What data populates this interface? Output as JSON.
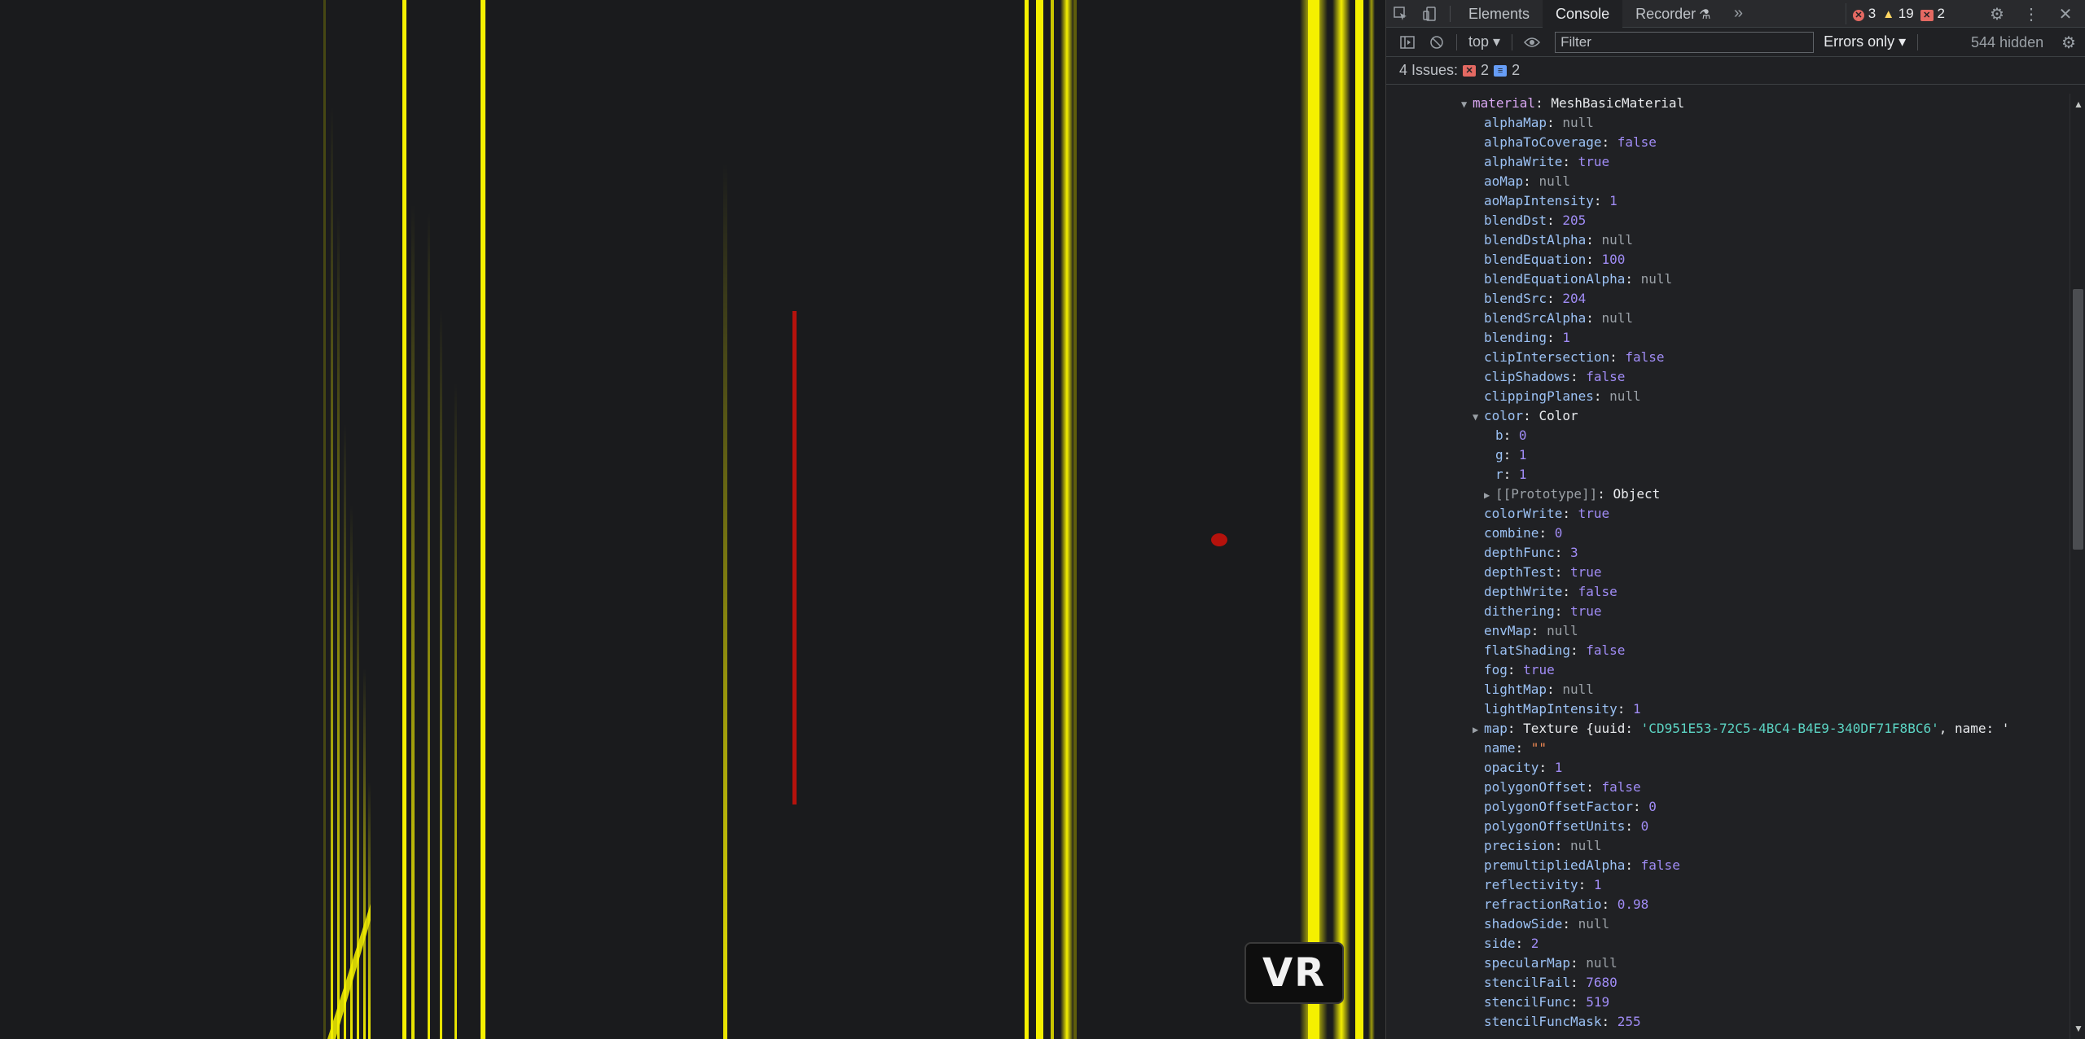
{
  "scene": {
    "vr_button_label": "VR"
  },
  "devtools": {
    "tabs": [
      {
        "label": "Elements",
        "active": false
      },
      {
        "label": "Console",
        "active": true
      },
      {
        "label": "Recorder",
        "active": false
      }
    ],
    "more_tabs_icon": "chevrons-right-icon",
    "counts": {
      "errors": "3",
      "warnings": "19",
      "issues": "2"
    },
    "toolbar": {
      "context": "top",
      "filter_placeholder": "Filter",
      "level": "Errors only",
      "hidden": "544 hidden"
    },
    "issues_bar": {
      "label": "4 Issues:",
      "errors": "2",
      "info": "2"
    },
    "object": {
      "name": "material",
      "type": "MeshBasicMaterial",
      "props": [
        {
          "key": "alphaMap",
          "value": "null",
          "kind": "null"
        },
        {
          "key": "alphaToCoverage",
          "value": "false",
          "kind": "bool"
        },
        {
          "key": "alphaWrite",
          "value": "true",
          "kind": "bool"
        },
        {
          "key": "aoMap",
          "value": "null",
          "kind": "null"
        },
        {
          "key": "aoMapIntensity",
          "value": "1",
          "kind": "num"
        },
        {
          "key": "blendDst",
          "value": "205",
          "kind": "num"
        },
        {
          "key": "blendDstAlpha",
          "value": "null",
          "kind": "null"
        },
        {
          "key": "blendEquation",
          "value": "100",
          "kind": "num"
        },
        {
          "key": "blendEquationAlpha",
          "value": "null",
          "kind": "null"
        },
        {
          "key": "blendSrc",
          "value": "204",
          "kind": "num"
        },
        {
          "key": "blendSrcAlpha",
          "value": "null",
          "kind": "null"
        },
        {
          "key": "blending",
          "value": "1",
          "kind": "num"
        },
        {
          "key": "clipIntersection",
          "value": "false",
          "kind": "bool"
        },
        {
          "key": "clipShadows",
          "value": "false",
          "kind": "bool"
        },
        {
          "key": "clippingPlanes",
          "value": "null",
          "kind": "null"
        },
        {
          "key": "color",
          "value": "Color",
          "kind": "plain",
          "expanded": true,
          "children": [
            {
              "key": "b",
              "value": "0",
              "kind": "num"
            },
            {
              "key": "g",
              "value": "1",
              "kind": "num"
            },
            {
              "key": "r",
              "value": "1",
              "kind": "num"
            },
            {
              "key": "[[Prototype]]",
              "value": "Object",
              "kind": "plain",
              "collapsed": true
            }
          ]
        },
        {
          "key": "colorWrite",
          "value": "true",
          "kind": "bool"
        },
        {
          "key": "combine",
          "value": "0",
          "kind": "num"
        },
        {
          "key": "depthFunc",
          "value": "3",
          "kind": "num"
        },
        {
          "key": "depthTest",
          "value": "true",
          "kind": "bool"
        },
        {
          "key": "depthWrite",
          "value": "false",
          "kind": "bool"
        },
        {
          "key": "dithering",
          "value": "true",
          "kind": "bool"
        },
        {
          "key": "envMap",
          "value": "null",
          "kind": "null"
        },
        {
          "key": "flatShading",
          "value": "false",
          "kind": "bool"
        },
        {
          "key": "fog",
          "value": "true",
          "kind": "bool"
        },
        {
          "key": "lightMap",
          "value": "null",
          "kind": "null"
        },
        {
          "key": "lightMapIntensity",
          "value": "1",
          "kind": "num"
        },
        {
          "key": "map",
          "value": "Texture {uuid: ",
          "kind": "plain",
          "collapsed": true,
          "uuid": "'CD951E53-72C5-4BC4-B4E9-340DF71F8BC6'",
          "tail": ", name: '"
        },
        {
          "key": "name",
          "value": "\"\"",
          "kind": "str"
        },
        {
          "key": "opacity",
          "value": "1",
          "kind": "num"
        },
        {
          "key": "polygonOffset",
          "value": "false",
          "kind": "bool"
        },
        {
          "key": "polygonOffsetFactor",
          "value": "0",
          "kind": "num"
        },
        {
          "key": "polygonOffsetUnits",
          "value": "0",
          "kind": "num"
        },
        {
          "key": "precision",
          "value": "null",
          "kind": "null"
        },
        {
          "key": "premultipliedAlpha",
          "value": "false",
          "kind": "bool"
        },
        {
          "key": "reflectivity",
          "value": "1",
          "kind": "num"
        },
        {
          "key": "refractionRatio",
          "value": "0.98",
          "kind": "num"
        },
        {
          "key": "shadowSide",
          "value": "null",
          "kind": "null"
        },
        {
          "key": "side",
          "value": "2",
          "kind": "num"
        },
        {
          "key": "specularMap",
          "value": "null",
          "kind": "null"
        },
        {
          "key": "stencilFail",
          "value": "7680",
          "kind": "num"
        },
        {
          "key": "stencilFunc",
          "value": "519",
          "kind": "num"
        },
        {
          "key": "stencilFuncMask",
          "value": "255",
          "kind": "num"
        }
      ]
    }
  },
  "colors": {
    "yellow": "#f5f000",
    "red": "#b5120c",
    "scene_bg": "#1a1b1d",
    "devtools_bg": "#202124"
  }
}
